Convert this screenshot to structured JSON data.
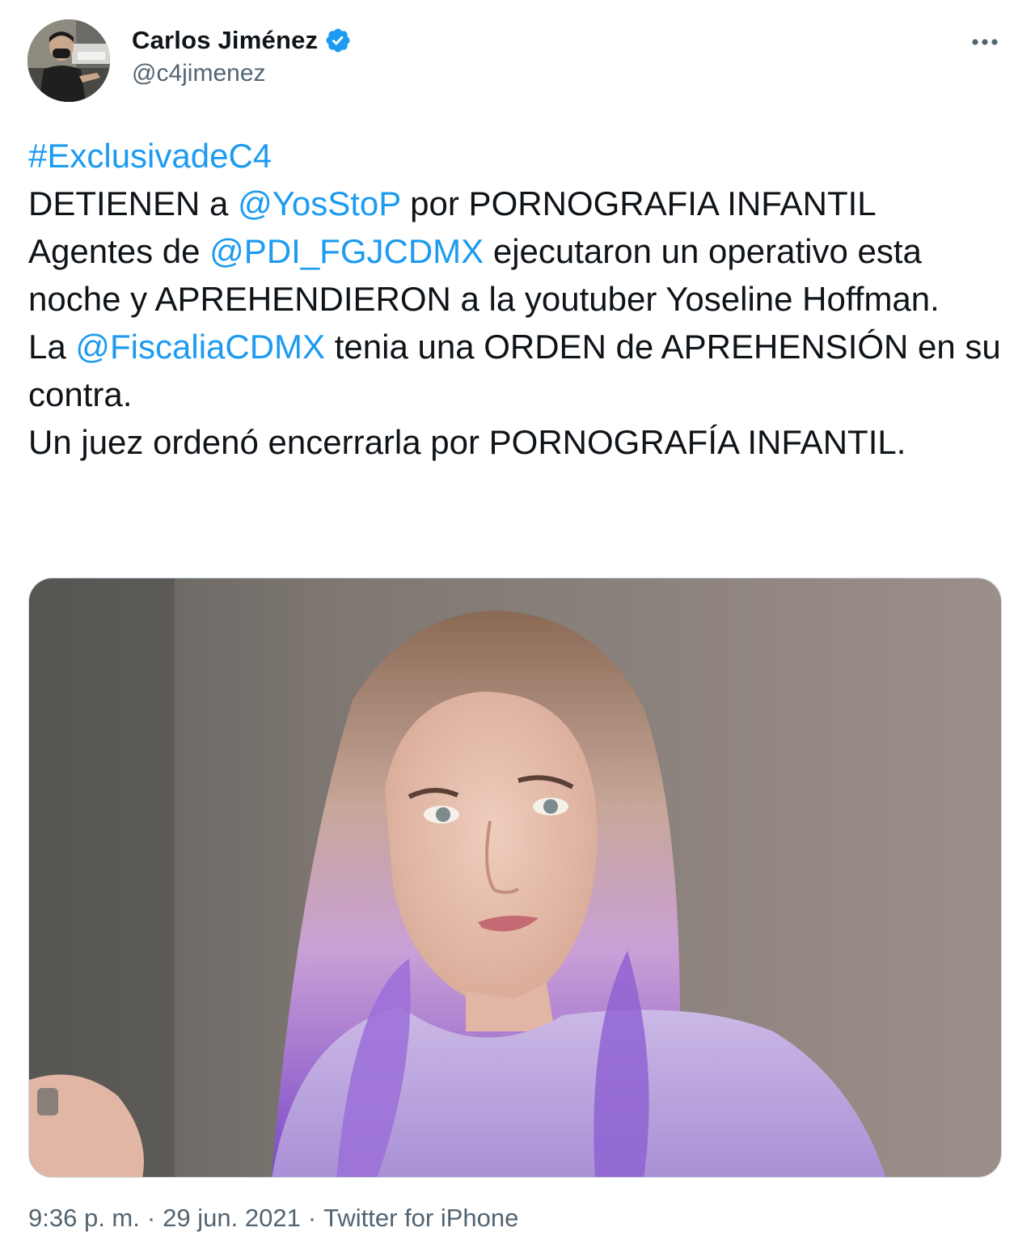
{
  "author": {
    "display_name": "Carlos Jiménez",
    "handle": "@c4jimenez",
    "verified": true,
    "avatar_icon": "profile-photo"
  },
  "more_icon": "more-horizontal-icon",
  "tweet": {
    "hashtag": "#ExclusivadeC4",
    "line1_a": "DETIENEN a ",
    "mention1": "@YosStoP",
    "line1_b": " por PORNOGRAFIA INFANTIL",
    "line2_a": "Agentes de ",
    "mention2": "@PDI_FGJCDMX",
    "line2_b": " ejecutaron un operativo esta noche y APREHENDIERON a la youtuber Yoseline Hoffman.",
    "line3_a": "La ",
    "mention3": "@FiscaliaCDMX",
    "line3_b": " tenia una ORDEN de APREHENSIÓN en su contra.",
    "line4": "Un juez ordenó encerrarla por PORNOGRAFÍA INFANTIL."
  },
  "media": {
    "kind": "photo"
  },
  "meta": {
    "time": "9:36 p. m.",
    "separator": "·",
    "date": "29 jun. 2021",
    "source": "Twitter for iPhone"
  },
  "colors": {
    "link": "#1d9bf0",
    "text": "#0f1419",
    "secondary": "#536471",
    "verified": "#1d9bf0"
  }
}
